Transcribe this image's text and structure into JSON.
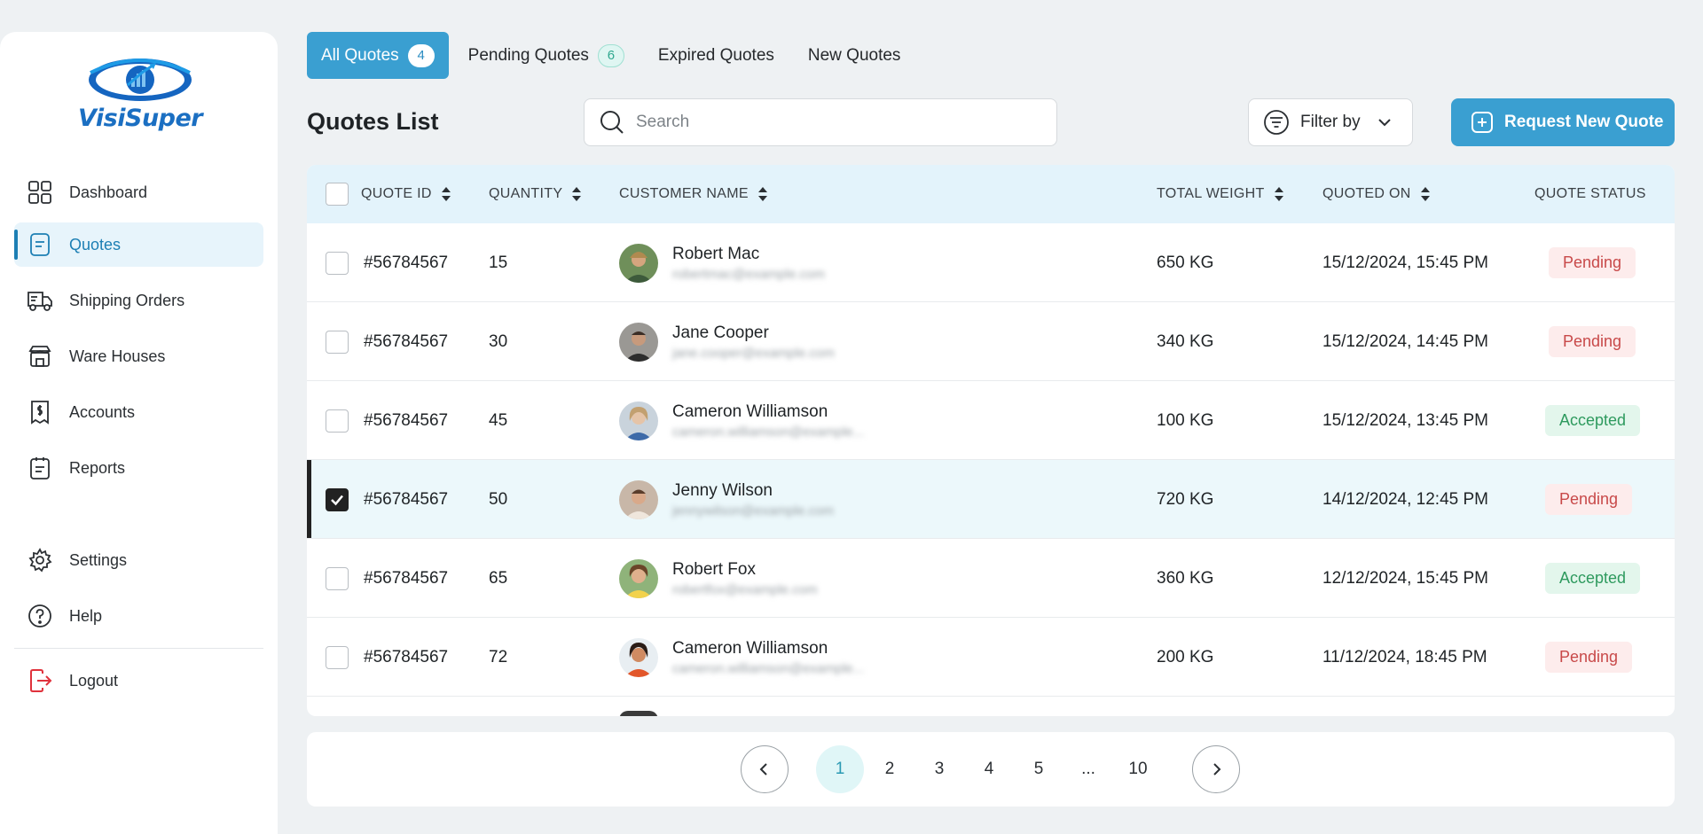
{
  "brand": {
    "name": "VisiSuper",
    "logo_icon": "eye-chart-logo",
    "accent": "#3a9fd1"
  },
  "sidebar": {
    "items": [
      {
        "label": "Dashboard",
        "icon": "grid-icon"
      },
      {
        "label": "Quotes",
        "icon": "document-icon",
        "active": true
      },
      {
        "label": "Shipping Orders",
        "icon": "truck-icon"
      },
      {
        "label": "Ware Houses",
        "icon": "warehouse-icon"
      },
      {
        "label": "Accounts",
        "icon": "receipt-icon"
      },
      {
        "label": "Reports",
        "icon": "report-icon"
      }
    ],
    "bottom": [
      {
        "label": "Settings",
        "icon": "gear-icon"
      },
      {
        "label": "Help",
        "icon": "help-icon"
      }
    ],
    "logout": {
      "label": "Logout",
      "icon": "logout-icon"
    }
  },
  "tabs": [
    {
      "label": "All Quotes",
      "badge": "4",
      "active": true
    },
    {
      "label": "Pending Quotes",
      "badge": "6"
    },
    {
      "label": "Expired Quotes"
    },
    {
      "label": "New Quotes"
    }
  ],
  "page_title": "Quotes List",
  "search": {
    "placeholder": "Search"
  },
  "filter": {
    "label": "Filter by"
  },
  "request_button": {
    "label": "Request New Quote"
  },
  "table": {
    "headers": {
      "quote_id": "QUOTE ID",
      "quantity": "QUANTITY",
      "customer": "CUSTOMER NAME",
      "weight": "TOTAL WEIGHT",
      "quoted_on": "QUOTED ON",
      "status": "QUOTE STATUS"
    },
    "rows": [
      {
        "id": "#56784567",
        "qty": "15",
        "name": "Robert Mac",
        "email": "robertmac@example.com",
        "weight": "650 KG",
        "date": "15/12/2024, 15:45 PM",
        "status": "Pending",
        "checked": false
      },
      {
        "id": "#56784567",
        "qty": "30",
        "name": "Jane Cooper",
        "email": "jane.cooper@example.com",
        "weight": "340 KG",
        "date": "15/12/2024, 14:45 PM",
        "status": "Pending",
        "checked": false
      },
      {
        "id": "#56784567",
        "qty": "45",
        "name": "Cameron Williamson",
        "email": "cameron.williamson@example...",
        "weight": "100 KG",
        "date": "15/12/2024, 13:45 PM",
        "status": "Accepted",
        "checked": false
      },
      {
        "id": "#56784567",
        "qty": "50",
        "name": "Jenny Wilson",
        "email": "jennywilson@example.com",
        "weight": "720 KG",
        "date": "14/12/2024, 12:45 PM",
        "status": "Pending",
        "checked": true
      },
      {
        "id": "#56784567",
        "qty": "65",
        "name": "Robert Fox",
        "email": "robertfox@example.com",
        "weight": "360 KG",
        "date": "12/12/2024, 15:45 PM",
        "status": "Accepted",
        "checked": false
      },
      {
        "id": "#56784567",
        "qty": "72",
        "name": "Cameron Williamson",
        "email": "cameron.williamson@example...",
        "weight": "200 KG",
        "date": "11/12/2024, 18:45 PM",
        "status": "Pending",
        "checked": false
      }
    ]
  },
  "pagination": {
    "pages": [
      "1",
      "2",
      "3",
      "4",
      "5",
      "...",
      "10"
    ],
    "current": "1"
  }
}
